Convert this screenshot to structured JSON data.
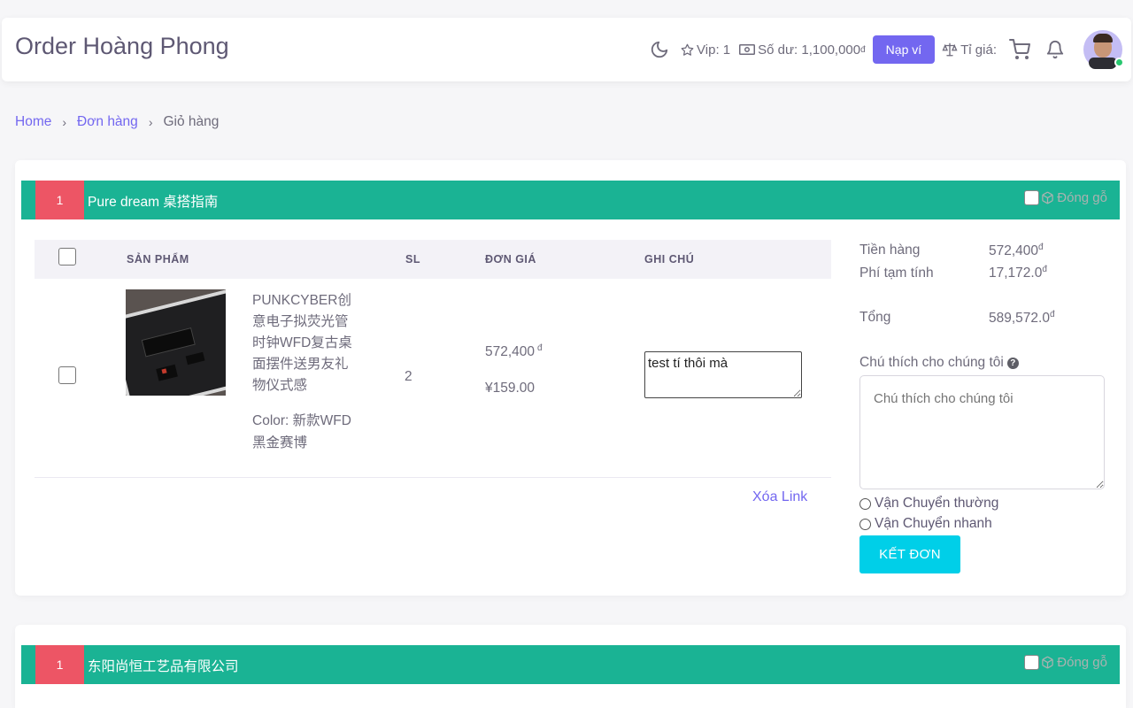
{
  "header": {
    "brand": "Order Hoàng Phong",
    "vip": "Vip: 1",
    "balance": "Số dư: 1,100,000",
    "currency_symbol": "đ",
    "topup_button": "Nạp ví",
    "exchange_rate": "Tỉ giá:"
  },
  "breadcrumb": {
    "home": "Home",
    "orders": "Đơn hàng",
    "current": "Giỏ hàng",
    "separator": "›"
  },
  "shops": [
    {
      "index": "1",
      "name": "Pure dream 桌搭指南",
      "packing_label": "Đóng gỗ",
      "table_headers": {
        "product": "SẢN PHẨM",
        "qty": "SL",
        "unit_price": "ĐƠN GIÁ",
        "note": "GHI CHÚ"
      },
      "item": {
        "title": "PUNKCYBER创意电子拟荧光管时钟WFD复古桌面摆件送男友礼物仪式感",
        "attributes": "Color: 新款WFD黑金赛博",
        "qty": "2",
        "price_vnd": "572,400",
        "price_vnd_symbol": "đ",
        "price_cny": "¥159.00",
        "note": "test tí thôi mà"
      },
      "remove_link": "Xóa Link",
      "summary": {
        "goods_label": "Tiền hàng",
        "goods_value": "572,400",
        "fee_label": "Phí tạm tính",
        "fee_value": "17,172.0",
        "total_label": "Tổng",
        "total_value": "589,572.0",
        "symbol": "đ"
      },
      "comment_label": "Chú thích cho chúng tôi",
      "comment_placeholder": "Chú thích cho chúng tôi",
      "shipping_options": [
        "Vận Chuyển thường",
        "Vận Chuyển nhanh"
      ],
      "checkout_button": "KẾT ĐƠN"
    },
    {
      "index": "1",
      "name": "东阳尚恒工艺品有限公司",
      "packing_label": "Đóng gỗ"
    }
  ],
  "colors": {
    "primary": "#7367f0",
    "shop_bar": "#1ab394",
    "shop_index": "#ed5565",
    "checkout": "#00cfe8"
  }
}
